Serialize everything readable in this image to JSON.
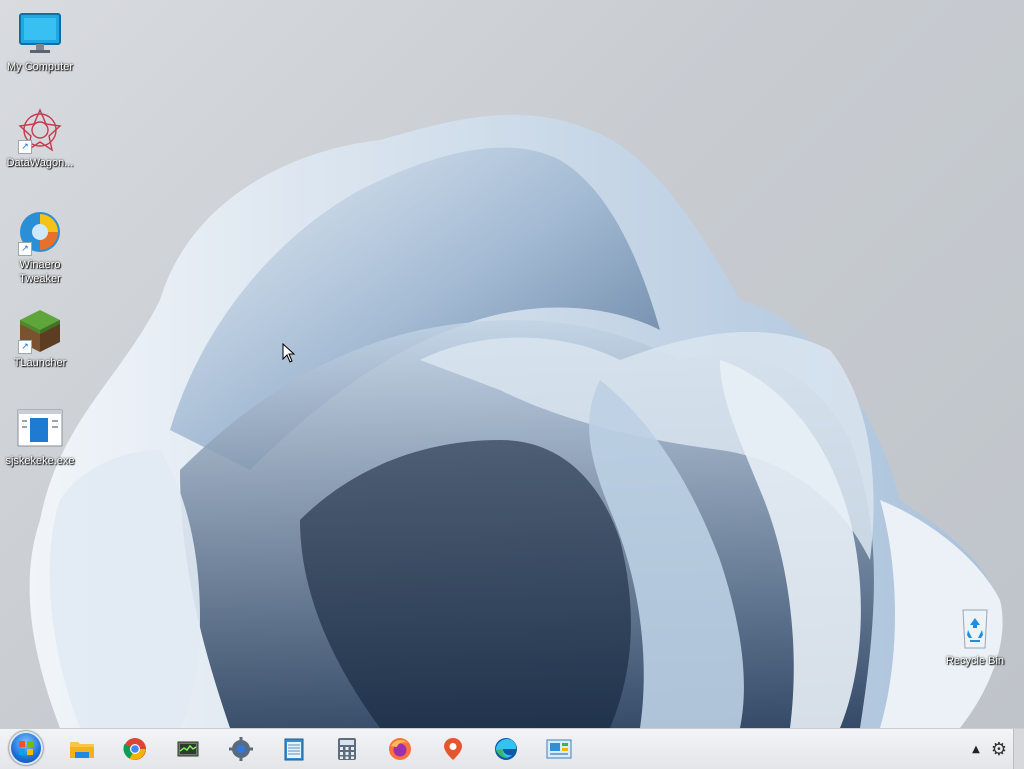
{
  "desktop": {
    "icons": [
      {
        "label": "My Computer",
        "icon": "monitor-icon"
      },
      {
        "label": "DataWagon...",
        "icon": "datawagon-icon"
      },
      {
        "label": "Winaero Tweaker",
        "icon": "winaero-icon"
      },
      {
        "label": "TLauncher",
        "icon": "grass-block-icon"
      },
      {
        "label": "sjskekeke.exe",
        "icon": "exe-window-icon"
      },
      {
        "label": "Recycle Bin",
        "icon": "recycle-bin-icon"
      }
    ]
  },
  "taskbar": {
    "start": {
      "icon": "windows-start-orb-icon"
    },
    "pinned": [
      {
        "name": "file-explorer",
        "icon": "folder-icon"
      },
      {
        "name": "chrome",
        "icon": "chrome-icon"
      },
      {
        "name": "task-manager",
        "icon": "task-manager-icon"
      },
      {
        "name": "settings",
        "icon": "settings-gear-icon"
      },
      {
        "name": "notepad",
        "icon": "notepad-icon"
      },
      {
        "name": "calculator",
        "icon": "calculator-icon"
      },
      {
        "name": "firefox",
        "icon": "firefox-icon"
      },
      {
        "name": "maps",
        "icon": "map-pin-icon"
      },
      {
        "name": "edge",
        "icon": "edge-icon"
      },
      {
        "name": "control-panel",
        "icon": "control-panel-icon"
      }
    ],
    "tray": {
      "overflow_icon": "chevron-up-icon",
      "settings_icon": "gear-icon"
    }
  }
}
